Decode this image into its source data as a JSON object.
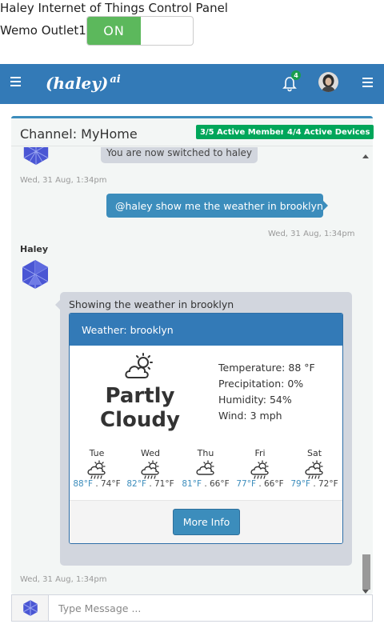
{
  "panel": {
    "title": "Haley Internet of Things Control Panel",
    "outlet_label": "Wemo Outlet1:",
    "toggle_state": "ON"
  },
  "navbar": {
    "logo_text": "(haley)",
    "logo_sup": "ai",
    "notification_count": "4",
    "color": "#337ab7"
  },
  "chat": {
    "channel_title": "Channel: MyHome",
    "members_badge": "3/5 Active Members",
    "devices_badge": "4/4 Active Devices",
    "messages": {
      "partial_text": "You are now switched to haley",
      "ts1": "Wed, 31 Aug, 1:34pm",
      "user_text": "@haley show me the weather in brooklyn",
      "ts2": "Wed, 31 Aug, 1:34pm",
      "sender": "Haley",
      "bot_text": "Showing the weather in brooklyn",
      "ts3": "Wed, 31 Aug, 1:34pm"
    },
    "weather": {
      "header": "Weather: brooklyn",
      "condition_line1": "Partly",
      "condition_line2": "Cloudy",
      "temperature": "Temperature: 88 °F",
      "precipitation": "Precipitation: 0%",
      "humidity": "Humidity: 54%",
      "wind": "Wind: 3 mph",
      "forecast": [
        {
          "day": "Tue",
          "hi": "88°F",
          "lo": "74°F",
          "icon": "rain-cloud-sun-icon"
        },
        {
          "day": "Wed",
          "hi": "82°F",
          "lo": "71°F",
          "icon": "rain-cloud-sun-icon"
        },
        {
          "day": "Thu",
          "hi": "81°F",
          "lo": "66°F",
          "icon": "partly-cloudy-icon"
        },
        {
          "day": "Fri",
          "hi": "77°F",
          "lo": "66°F",
          "icon": "rain-cloud-sun-icon"
        },
        {
          "day": "Sat",
          "hi": "79°F",
          "lo": "72°F",
          "icon": "rain-cloud-sun-icon"
        }
      ],
      "separator": " . ",
      "more_info": "More Info"
    },
    "input_placeholder": "Type Message ..."
  },
  "colors": {
    "primary": "#337ab7",
    "success": "#5cb85c",
    "badge": "#00a65a",
    "bubble": "#d2d6de"
  }
}
